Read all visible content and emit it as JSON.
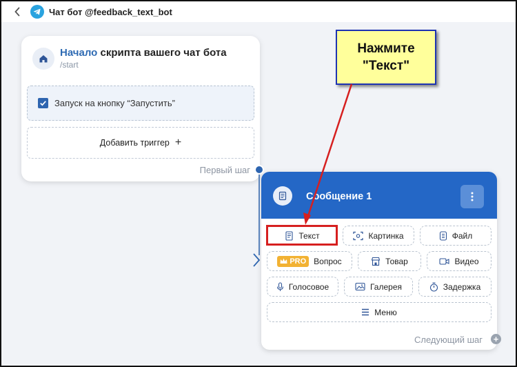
{
  "header": {
    "title": "Чат бот @feedback_text_bot",
    "back_icon": "chevron-left-icon",
    "app_icon": "telegram-icon",
    "accent": "#2aa3df"
  },
  "start_card": {
    "title_accent": "Начало",
    "title_rest": " скрипта вашего чат бота",
    "subtitle": "/start",
    "icon": "home-icon",
    "trigger": {
      "label": "Запуск на кнопку “Запустить”",
      "checked": true
    },
    "add_trigger_label": "Добавить триггер",
    "add_trigger_symbol": "+",
    "footer": "Первый шаг"
  },
  "message_card": {
    "title": "Сообщение 1",
    "header_color": "#2467c6",
    "icon": "message-icon",
    "menu_icon": "more-vertical-icon",
    "buttons": [
      {
        "label": "Текст",
        "icon": "text-doc-icon"
      },
      {
        "label": "Картинка",
        "icon": "image-scan-icon"
      },
      {
        "label": "Файл",
        "icon": "file-icon"
      },
      {
        "label": "Вопрос",
        "icon": "crown-icon",
        "badge": "PRO"
      },
      {
        "label": "Товар",
        "icon": "store-icon"
      },
      {
        "label": "Видео",
        "icon": "video-icon"
      },
      {
        "label": "Голосовое",
        "icon": "microphone-icon"
      },
      {
        "label": "Галерея",
        "icon": "gallery-icon"
      },
      {
        "label": "Задержка",
        "icon": "timer-icon"
      },
      {
        "label": "Меню",
        "icon": "menu-icon"
      }
    ],
    "footer": "Следующий шаг",
    "footer_symbol": "+"
  },
  "callout": {
    "line1": "Нажмите",
    "line2": "\"Текст\"",
    "background": "#ffff9b",
    "border": "#1d33b3",
    "arrow_color": "#d61f1f"
  }
}
